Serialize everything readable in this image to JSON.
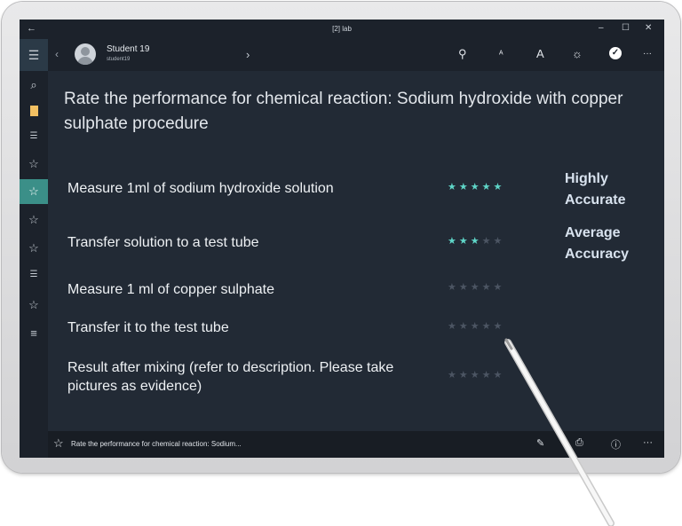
{
  "window": {
    "title": "[2] lab",
    "back": "←",
    "minimize": "–",
    "maximize": "☐",
    "close": "✕"
  },
  "toolbar": {
    "menu": "☰",
    "prev": "‹",
    "next": "›",
    "user_name": "Student 19",
    "user_id": "student19",
    "icons": [
      "person-key-icon",
      "text-decrease-icon",
      "text-increase-icon",
      "brightness-icon",
      "check-circle-icon",
      "more-icon"
    ],
    "glyphs": {
      "person": "⚲",
      "font_small": "ᴬ",
      "font_large": "A",
      "brightness": "☼",
      "check": "✓",
      "more": "···"
    }
  },
  "sidebar": {
    "items": [
      {
        "icon": "search-icon",
        "glyph": "⌕"
      },
      {
        "icon": "note-icon",
        "glyph": ""
      },
      {
        "icon": "list-icon",
        "glyph": "☰"
      },
      {
        "icon": "star-icon",
        "glyph": "☆"
      },
      {
        "icon": "star-icon",
        "glyph": "☆",
        "active": true
      },
      {
        "icon": "star-icon",
        "glyph": "☆"
      },
      {
        "icon": "star-icon",
        "glyph": "☆"
      },
      {
        "icon": "list-icon",
        "glyph": "☰"
      },
      {
        "icon": "star-icon",
        "glyph": "☆"
      },
      {
        "icon": "list-icon",
        "glyph": "≡"
      }
    ]
  },
  "main": {
    "heading": "Rate the performance for chemical reaction: Sodium hydroxide with copper sulphate procedure",
    "rows": [
      {
        "label": "Measure 1ml of sodium hydroxide solution",
        "rating": 5,
        "max": 5
      },
      {
        "label": "Transfer solution to a test tube",
        "rating": 3,
        "max": 5
      },
      {
        "label": "Measure 1 ml of copper sulphate",
        "rating": 0,
        "max": 5
      },
      {
        "label": "Transfer it to the test tube",
        "rating": 0,
        "max": 5
      },
      {
        "label": "Result after mixing (refer to description. Please take pictures as evidence)",
        "rating": 0,
        "max": 5
      }
    ],
    "accuracy_labels": [
      "Highly Accurate",
      "Average Accuracy"
    ]
  },
  "statusbar": {
    "text": "Rate the performance for chemical reaction: Sodium...",
    "star": "☆",
    "icons": {
      "edit": "✎",
      "attach": "⎙",
      "info": "ⓘ",
      "more": "···"
    }
  },
  "colors": {
    "screen_bg": "#222a35",
    "accent": "#3b8f88",
    "star_on": "#5fd6c8",
    "star_off": "#4c5563"
  }
}
